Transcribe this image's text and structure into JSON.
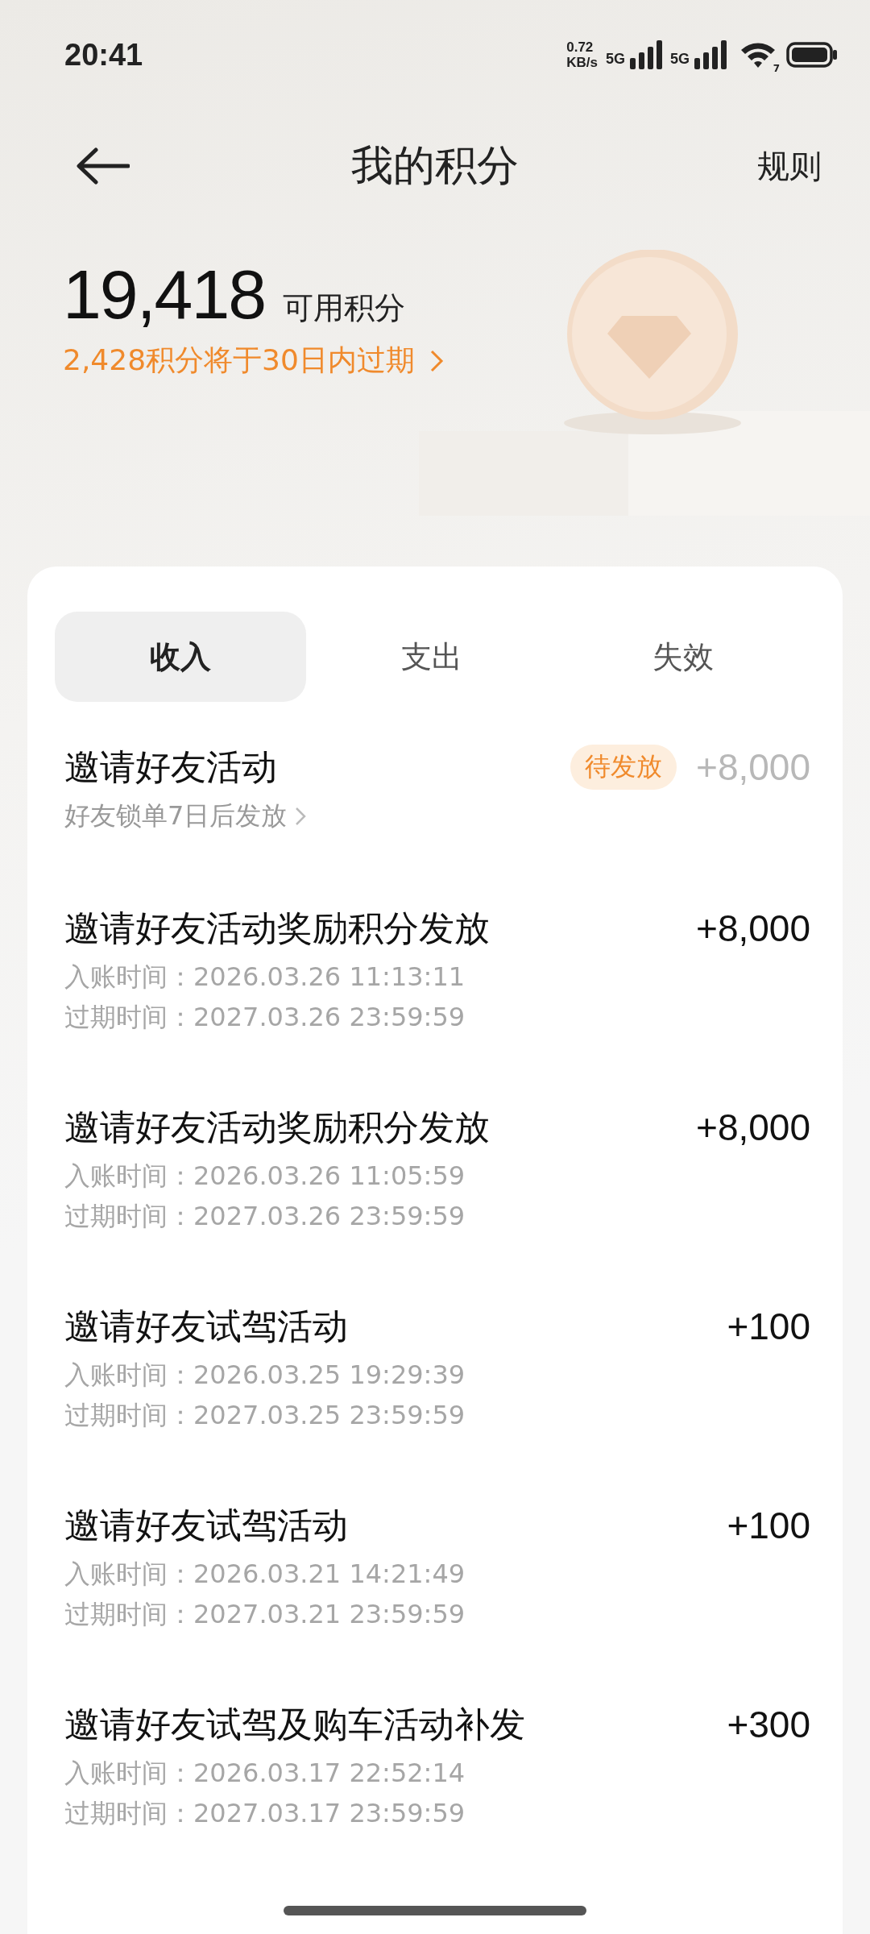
{
  "status_bar": {
    "time": "20:41",
    "net_speed": {
      "value": "0.72",
      "unit": "KB/s"
    },
    "sims": [
      {
        "network": "5G"
      },
      {
        "network": "5G"
      }
    ],
    "wifi_badge": "7"
  },
  "header": {
    "title": "我的积分",
    "action": "规则"
  },
  "balance": {
    "value": "19,418",
    "label": "可用积分",
    "expiry_notice": "2,428积分将于30日内过期"
  },
  "tabs": [
    {
      "label": "收入",
      "selected": true
    },
    {
      "label": "支出",
      "selected": false
    },
    {
      "label": "失效",
      "selected": false
    }
  ],
  "records": [
    {
      "kind": "pending",
      "title": "邀请好友活动",
      "badge": "待发放",
      "amount": "+8,000",
      "note": "好友锁单7日后发放"
    },
    {
      "kind": "record",
      "title": "邀请好友活动奖励积分发放",
      "amount": "+8,000",
      "lines": [
        {
          "label": "入账时间：",
          "value": "2026.03.26 11:13:11"
        },
        {
          "label": "过期时间：",
          "value": "2027.03.26 23:59:59"
        }
      ]
    },
    {
      "kind": "record",
      "title": "邀请好友活动奖励积分发放",
      "amount": "+8,000",
      "lines": [
        {
          "label": "入账时间：",
          "value": "2026.03.26 11:05:59"
        },
        {
          "label": "过期时间：",
          "value": "2027.03.26 23:59:59"
        }
      ]
    },
    {
      "kind": "record",
      "title": "邀请好友试驾活动",
      "amount": "+100",
      "lines": [
        {
          "label": "入账时间：",
          "value": "2026.03.25 19:29:39"
        },
        {
          "label": "过期时间：",
          "value": "2027.03.25 23:59:59"
        }
      ]
    },
    {
      "kind": "record",
      "title": "邀请好友试驾活动",
      "amount": "+100",
      "lines": [
        {
          "label": "入账时间：",
          "value": "2026.03.21 14:21:49"
        },
        {
          "label": "过期时间：",
          "value": "2027.03.21 23:59:59"
        }
      ]
    },
    {
      "kind": "record",
      "title": "邀请好友试驾及购车活动补发",
      "amount": "+300",
      "lines": [
        {
          "label": "入账时间：",
          "value": "2026.03.17 22:52:14"
        },
        {
          "label": "过期时间：",
          "value": "2027.03.17 23:59:59"
        }
      ]
    }
  ]
}
